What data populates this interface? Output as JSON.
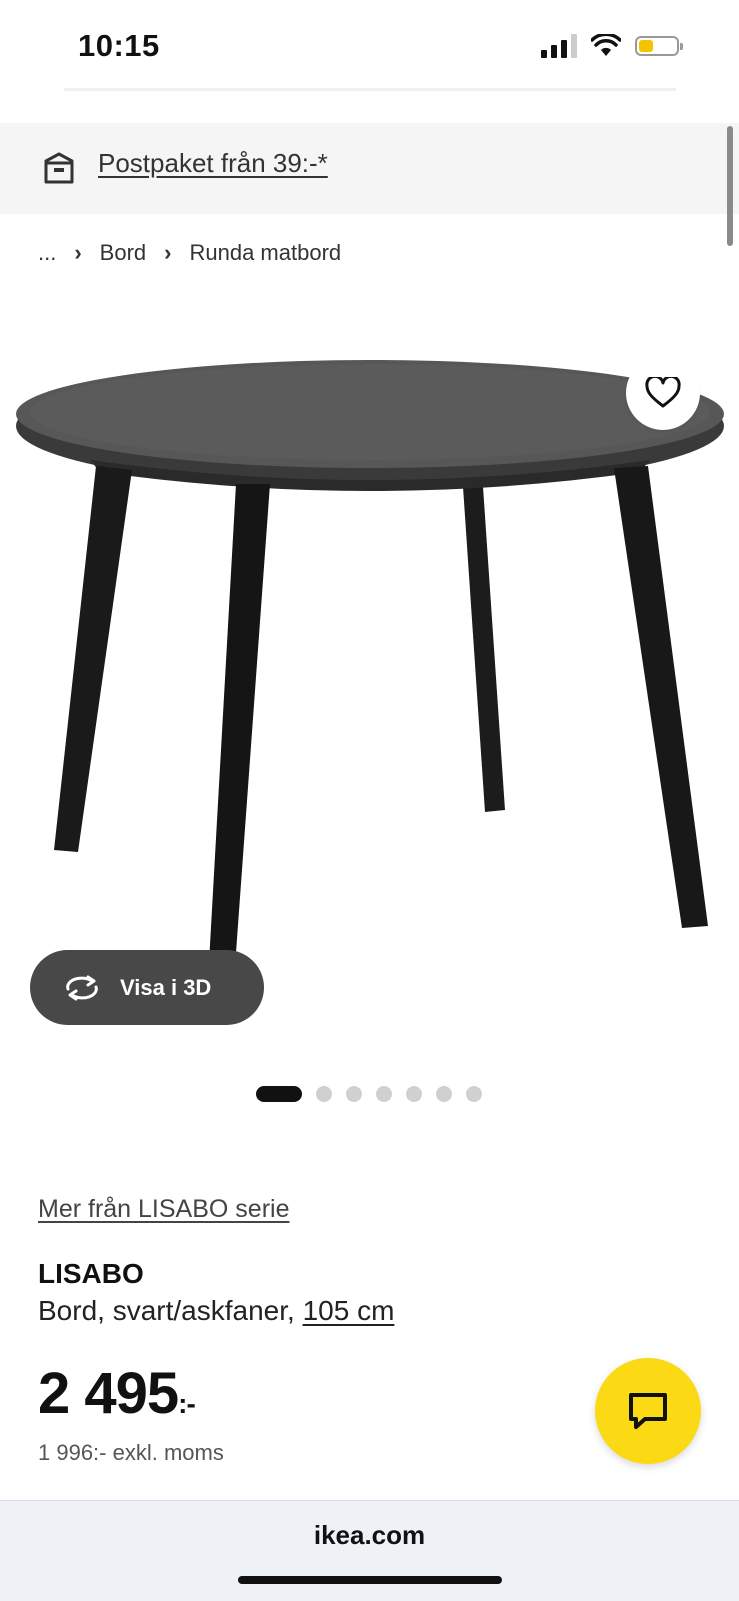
{
  "status": {
    "time": "10:15",
    "icons": [
      "cellular-signal-icon",
      "wifi-icon",
      "battery-icon"
    ]
  },
  "banner": {
    "text": "Postpaket från 39:-*",
    "icon": "parcel-box-icon"
  },
  "breadcrumb": {
    "ellipsis": "...",
    "items": [
      "Bord",
      "Runda matbord"
    ],
    "separator": "›"
  },
  "gallery": {
    "image": "black round dining table",
    "view3d_label": "Visa i 3D",
    "page_count": 7,
    "active_page": 1
  },
  "product": {
    "series_link": "Mer från LISABO serie",
    "name": "LISABO",
    "description": "Bord, svart/askfaner,",
    "size": "105 cm",
    "price_main": "2 495",
    "price_suffix": ":-",
    "price_excl": "1 996:- exkl. moms"
  },
  "browser": {
    "url": "ikea.com"
  },
  "colors": {
    "chat_button": "#fbd914",
    "banner_bg": "#f5f5f5",
    "view3d_bg": "#484848"
  }
}
